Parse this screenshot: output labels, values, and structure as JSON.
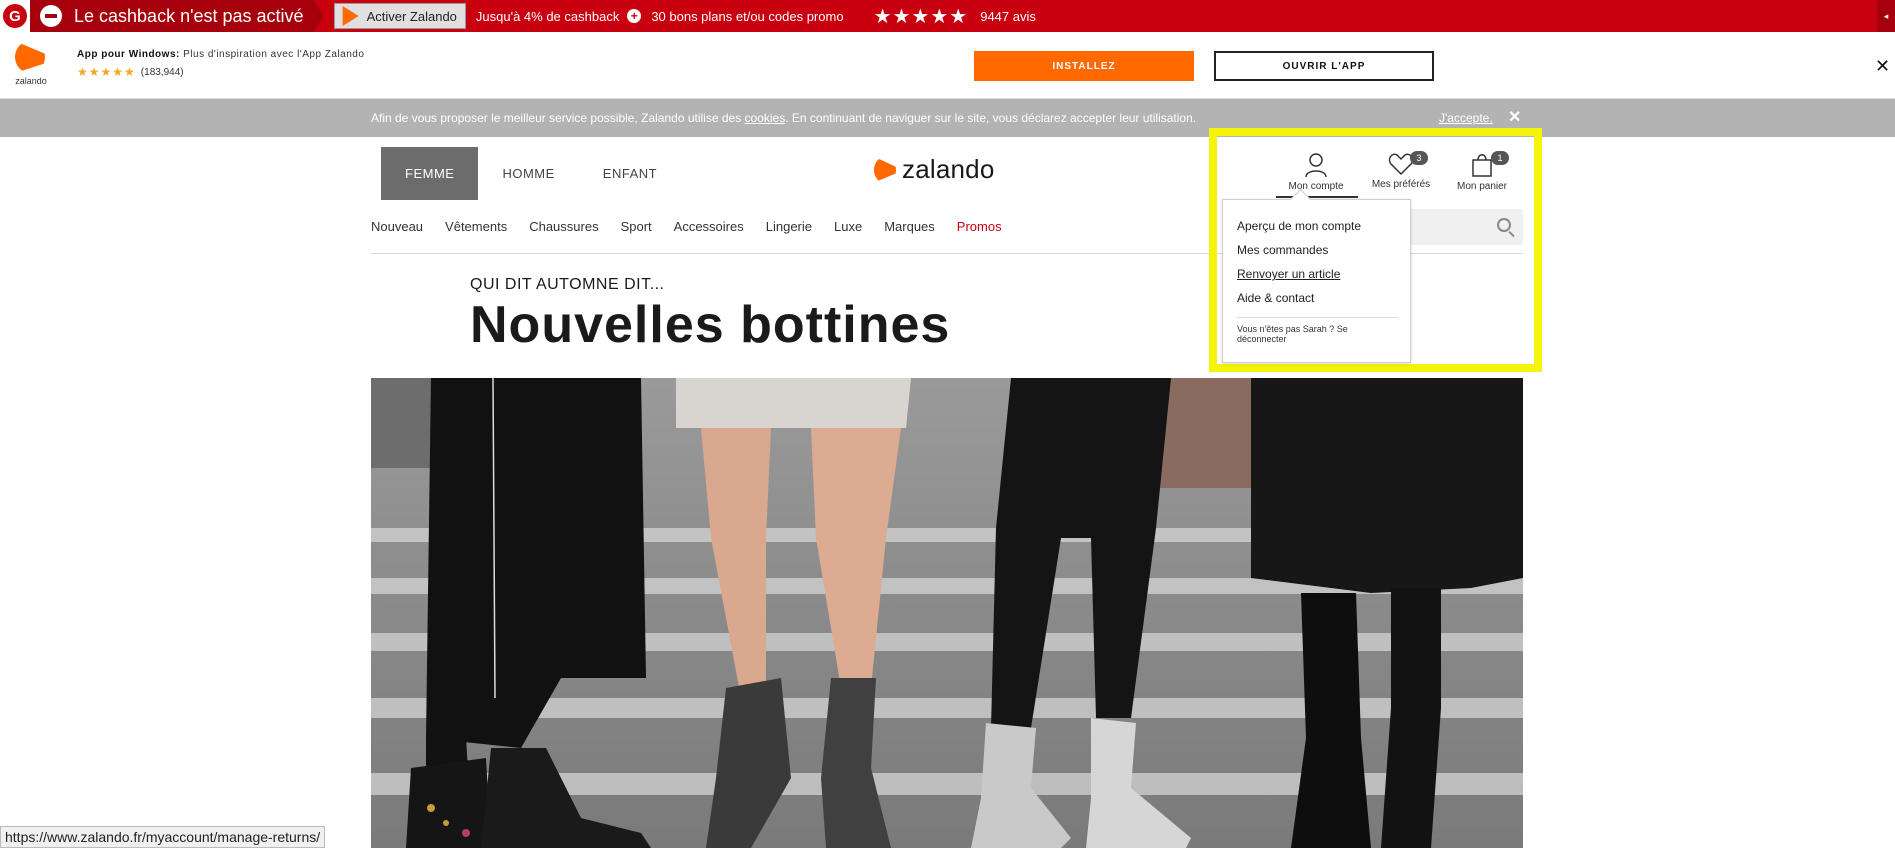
{
  "cashback_bar": {
    "status": "Le cashback n'est pas activé",
    "activate_label": "Activer Zalando",
    "cashback_rate": "Jusqu'à 4% de cashback",
    "deals": "30 bons plans et/ou codes promo",
    "stars": "★★★★★",
    "reviews": "9447 avis",
    "collapse": "◂"
  },
  "app_banner": {
    "logo_text": "zalando",
    "title_bold": "App pour Windows:",
    "title_rest": " Plus d'inspiration avec l'App Zalando",
    "stars": "★★★★★",
    "rating_count": "(183,944)",
    "install_label": "INSTALLEZ",
    "open_label": "OUVRIR L'APP",
    "close": "✕"
  },
  "cookie_bar": {
    "text_before": "Afin de vous proposer le meilleur service possible, Zalando utilise des ",
    "link": "cookies",
    "text_after": ". En continuant de naviguer sur le site, vous déclarez accepter leur utilisation.",
    "accept": "J'accepte.",
    "close": "✕"
  },
  "header": {
    "genders": [
      "FEMME",
      "HOMME",
      "ENFANT"
    ],
    "brand": "zalando",
    "categories": [
      "Nouveau",
      "Vêtements",
      "Chaussures",
      "Sport",
      "Accessoires",
      "Lingerie",
      "Luxe",
      "Marques",
      "Promos"
    ],
    "account_label": "Mon compte",
    "wishlist_label": "Mes préférés",
    "wishlist_count": "3",
    "cart_label": "Mon panier",
    "cart_count": "1"
  },
  "account_menu": {
    "items": [
      "Aperçu de mon compte",
      "Mes commandes",
      "Renvoyer un article",
      "Aide & contact"
    ],
    "logout": "Vous n'êtes pas Sarah ? Se déconnecter"
  },
  "hero": {
    "kicker": "QUI DIT AUTOMNE DIT...",
    "title": "Nouvelles bottines"
  },
  "status_bar": {
    "url": "https://www.zalando.fr/myaccount/manage-returns/"
  },
  "colors": {
    "cashback_red": "#c8000f",
    "zalando_orange": "#ff6900",
    "highlight_yellow": "#f4f40a",
    "promo_red": "#c8000f"
  }
}
